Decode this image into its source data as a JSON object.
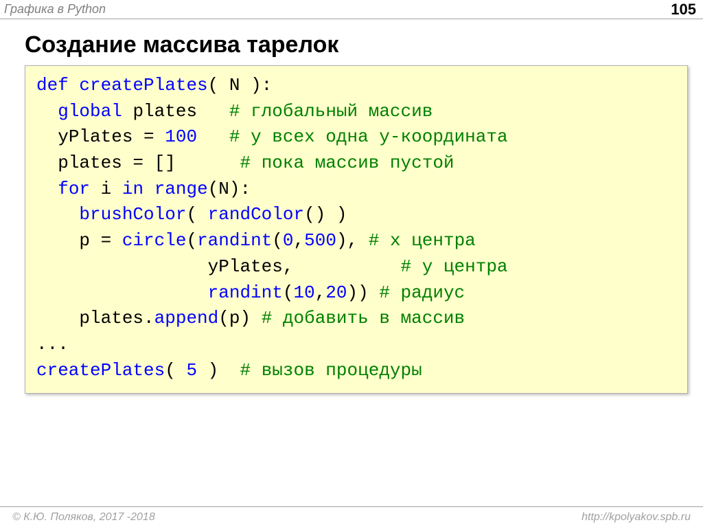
{
  "topbar": {
    "title": "Графика в Python",
    "page_number": "105"
  },
  "heading": "Создание массива тарелок",
  "code": {
    "l1": {
      "kw_def": "def",
      "fname": "createPlates",
      "punct_open": "(",
      "arg_spaced": " N ",
      "punct_close_colon": "):"
    },
    "l2": {
      "indent": "  ",
      "kw_global": "global",
      "sp": " ",
      "var": "plates",
      "gap": "   ",
      "cm": "# глобальный массив"
    },
    "l3": {
      "indent": "  ",
      "lhs": "yPlates = ",
      "num": "100",
      "gap": "   ",
      "cm": "# у всех одна y-координата"
    },
    "l4": {
      "indent": "  ",
      "lhs": "plates = []",
      "gap": "      ",
      "cm": "# пока массив пустой"
    },
    "l5": {
      "indent": "  ",
      "kw_for": "for",
      "sp1": " ",
      "var_i": "i",
      "sp2": " ",
      "kw_in": "in",
      "sp3": " ",
      "fn_range": "range",
      "tail": "(N):"
    },
    "l6": {
      "indent": "    ",
      "fn_brush": "brushColor",
      "open": "( ",
      "fn_randc": "randColor",
      "close": "() )"
    },
    "l7": {
      "indent": "    ",
      "lhs": "p = ",
      "fn_circle": "circle",
      "open": "(",
      "fn_randint": "randint",
      "p1": "(",
      "a0": "0",
      "comma": ",",
      "a1": "500",
      "p2": "), ",
      "cm": "# x центра"
    },
    "l8": {
      "indent": "                ",
      "var": "yPlates,",
      "gap": "          ",
      "cm": "# y центра"
    },
    "l9": {
      "indent": "                ",
      "fn_randint": "randint",
      "p1": "(",
      "a0": "10",
      "comma": ",",
      "a1": "20",
      "p2": ")) ",
      "cm": "# радиус"
    },
    "l10": {
      "indent": "    ",
      "obj": "plates.",
      "fn_append": "append",
      "tail": "(p) ",
      "cm": "# добавить в массив"
    },
    "l11": {
      "text": "..."
    },
    "l12": {
      "fn": "createPlates",
      "open": "( ",
      "arg": "5",
      "close": " )  ",
      "cm": "# вызов процедуры"
    }
  },
  "footer": {
    "copyright": "© К.Ю. Поляков, 2017 -2018",
    "url": "http://kpolyakov.spb.ru"
  }
}
